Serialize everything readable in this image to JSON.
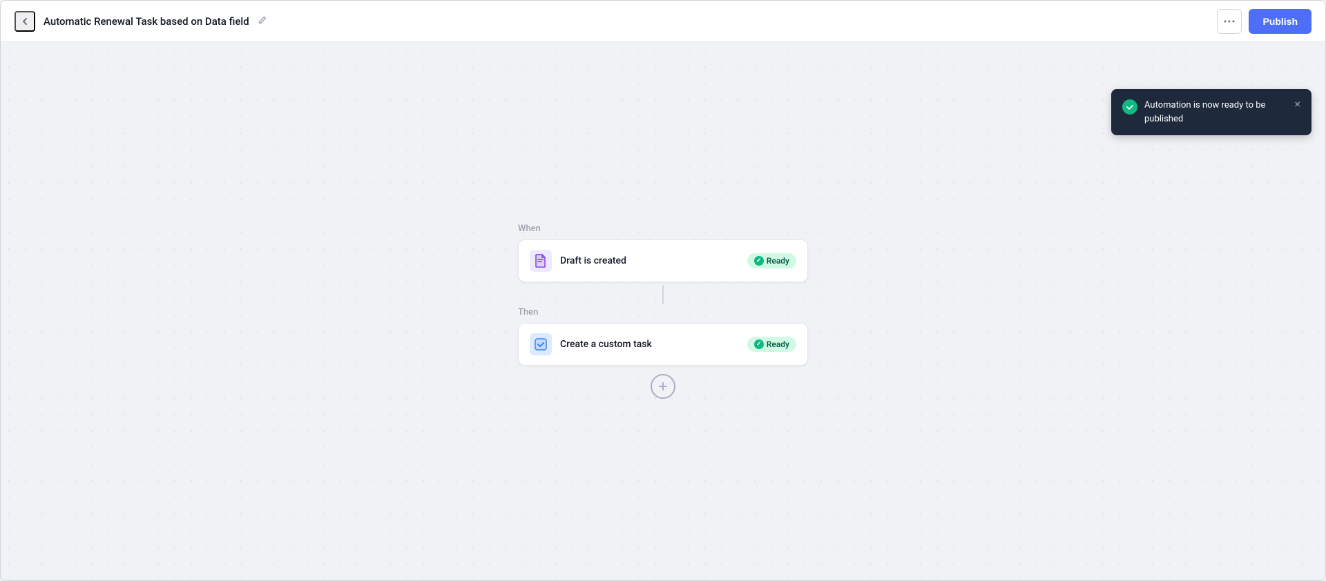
{
  "header": {
    "title": "Automatic Renewal Task based on Data field",
    "back_label": "‹",
    "more_label": "•••",
    "publish_label": "Publish"
  },
  "flow": {
    "when_label": "When",
    "then_label": "Then",
    "trigger": {
      "label": "Draft is created",
      "status": "Ready"
    },
    "action": {
      "label": "Create a custom task",
      "status": "Ready"
    },
    "add_label": "+"
  },
  "toast": {
    "message": "Automation is now ready to be published",
    "close_label": "×"
  },
  "icons": {
    "back": "‹",
    "edit": "✏",
    "more": "•••",
    "checkmark": "✓",
    "draft_icon": "file",
    "task_icon": "checkbox"
  }
}
